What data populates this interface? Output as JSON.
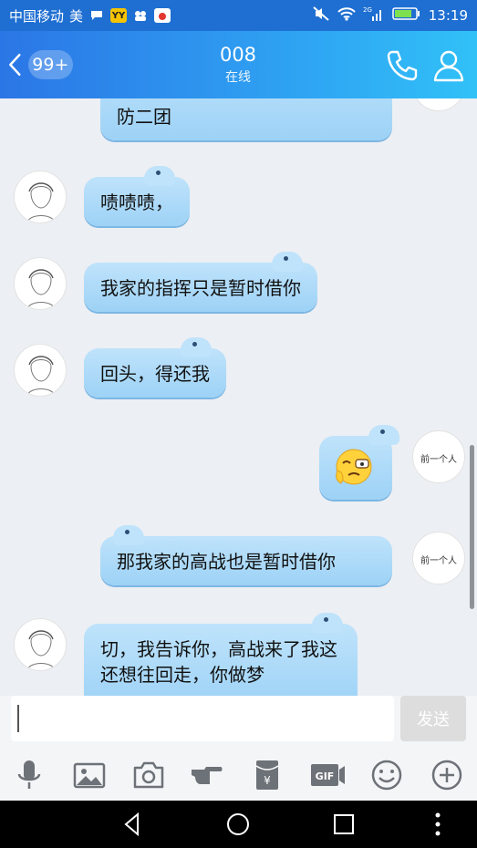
{
  "status_bar": {
    "carrier": "中国移动",
    "extra": "美",
    "time": "13:19",
    "network": "2G"
  },
  "header": {
    "unread_count": "99+",
    "contact_name": "008",
    "presence": "在线"
  },
  "messages": [
    {
      "side": "right",
      "text": "防二团"
    },
    {
      "side": "left",
      "text": "啧啧啧，"
    },
    {
      "side": "left",
      "text": "我家的指挥只是暂时借你"
    },
    {
      "side": "left",
      "text": "回头，得还我"
    },
    {
      "side": "right",
      "type": "emoji",
      "icon": "face-emoji"
    },
    {
      "side": "right",
      "text": "那我家的高战也是暂时借你"
    },
    {
      "side": "left",
      "text": "切，我告诉你，高战来了我这还想往回走，你做梦"
    }
  ],
  "self_avatar_text": "前一个人",
  "input": {
    "value": "",
    "send_label": "发送"
  },
  "toolbar": [
    "mic-icon",
    "image-icon",
    "camera-icon",
    "hand-icon",
    "red-envelope-icon",
    "gif-icon",
    "emoji-icon",
    "plus-icon"
  ],
  "colors": {
    "header_start": "#2b76e6",
    "header_end": "#31c1f7",
    "bubble": "#bfe3fb"
  }
}
